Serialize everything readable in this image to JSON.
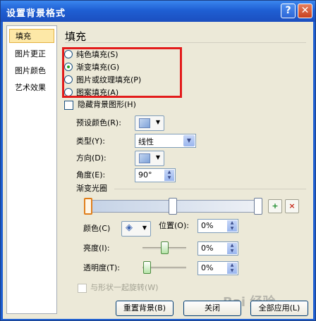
{
  "window": {
    "title": "设置背景格式",
    "help_label": "?",
    "close_label": "✕"
  },
  "nav": {
    "items": [
      {
        "label": "填充",
        "selected": true
      },
      {
        "label": "图片更正",
        "selected": false
      },
      {
        "label": "图片颜色",
        "selected": false
      },
      {
        "label": "艺术效果",
        "selected": false
      }
    ]
  },
  "fill": {
    "heading": "填充",
    "options": [
      {
        "label": "纯色填充(S)",
        "checked": false
      },
      {
        "label": "渐变填充(G)",
        "checked": true
      },
      {
        "label": "图片或纹理填充(P)",
        "checked": false
      },
      {
        "label": "图案填充(A)",
        "checked": false
      }
    ],
    "hide_bg_label": "隐藏背景图形(H)",
    "preset_label": "预设颜色(R):",
    "type_label": "类型(Y):",
    "type_value": "线性",
    "direction_label": "方向(D):",
    "angle_label": "角度(E):",
    "angle_value": "90°",
    "stops_label": "渐变光圈",
    "color_label": "颜色(C)",
    "position_label": "位置(O):",
    "position_value": "0%",
    "brightness_label": "亮度(I):",
    "brightness_value": "0%",
    "transparency_label": "透明度(T):",
    "transparency_value": "0%",
    "rotate_label": "与形状一起旋转(W)"
  },
  "buttons": {
    "reset": "重置背景(B)",
    "close": "关闭",
    "apply_all": "全部应用(L)"
  },
  "watermark": "Bai 经验",
  "colors": {
    "title_bar": "#1f5fd3",
    "selection": "#fde8a7",
    "highlight_box": "#e31b1b",
    "radio_dot": "#21a121"
  }
}
